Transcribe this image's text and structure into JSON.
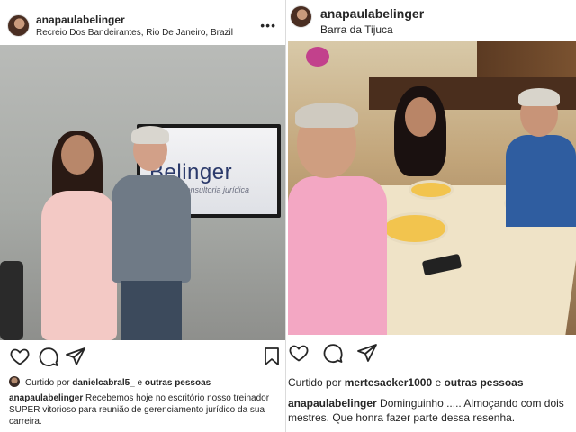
{
  "left_post": {
    "username": "anapaulabelinger",
    "location": "Recreio Dos Bandeirantes, Rio De Janeiro, Brazil",
    "more_icon": "more-dots-icon",
    "photo": {
      "screen_brand": "Belinger",
      "screen_subtitle": "consultoria jurídica"
    },
    "actions": {
      "like_icon": "heart-icon",
      "comment_icon": "comment-icon",
      "share_icon": "paper-plane-icon",
      "save_icon": "bookmark-icon"
    },
    "likes": {
      "prefix": "Curtido por ",
      "user": "danielcabral5_",
      "joiner": " e ",
      "others": "outras pessoas"
    },
    "caption": {
      "username": "anapaulabelinger",
      "text": " Recebemos hoje no escritório nosso treinador SUPER vitorioso para reunião de gerenciamento jurídico da sua carreira."
    }
  },
  "right_post": {
    "username": "anapaulabelinger",
    "location": "Barra da Tijuca",
    "actions": {
      "like_icon": "heart-icon",
      "comment_icon": "comment-icon",
      "share_icon": "paper-plane-icon"
    },
    "likes": {
      "prefix": "Curtido por ",
      "user": "mertesacker1000",
      "joiner": " e ",
      "others": "outras pessoas"
    },
    "caption": {
      "username": "anapaulabelinger",
      "text": " Dominguinho ..... Almoçando com dois mestres. Que honra fazer parte dessa resenha."
    }
  },
  "colors": {
    "text": "#262626",
    "divider": "#dbdbdb",
    "screen_brand": "#2b3a6b"
  }
}
